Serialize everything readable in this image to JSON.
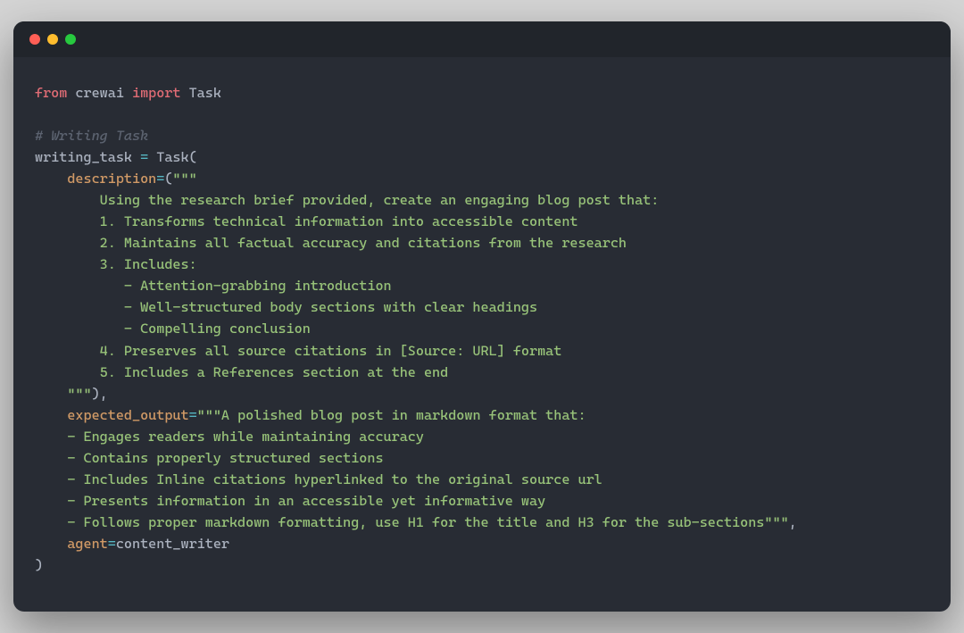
{
  "code": {
    "line1_from": "from",
    "line1_module": " crewai ",
    "line1_import": "import",
    "line1_name": " Task",
    "line3_comment": "# Writing Task",
    "line4_var": "writing_task ",
    "line4_eq": "=",
    "line4_call": " Task(",
    "line5_indent": "    ",
    "line5_param": "description",
    "line5_eq": "=",
    "line5_paren": "(",
    "line5_str_open": "\"\"\"",
    "line6": "        Using the research brief provided, create an engaging blog post that:",
    "line7": "        1. Transforms technical information into accessible content",
    "line8": "        2. Maintains all factual accuracy and citations from the research",
    "line9": "        3. Includes:",
    "line10": "           - Attention-grabbing introduction",
    "line11": "           - Well-structured body sections with clear headings",
    "line12": "           - Compelling conclusion",
    "line13": "        4. Preserves all source citations in [Source: URL] format",
    "line14": "        5. Includes a References section at the end",
    "line15_indent": "    ",
    "line15_str_close": "\"\"\"",
    "line15_close": "),",
    "line16_indent": "    ",
    "line16_param": "expected_output",
    "line16_eq": "=",
    "line16_str": "\"\"\"A polished blog post in markdown format that:",
    "line17": "    - Engages readers while maintaining accuracy",
    "line18": "    - Contains properly structured sections",
    "line19": "    - Includes Inline citations hyperlinked to the original source url",
    "line20": "    - Presents information in an accessible yet informative way",
    "line21": "    - Follows proper markdown formatting, use H1 for the title and H3 for the sub-sections\"\"\"",
    "line21_comma": ",",
    "line22_indent": "    ",
    "line22_param": "agent",
    "line22_eq": "=",
    "line22_val": "content_writer",
    "line23": ")"
  }
}
